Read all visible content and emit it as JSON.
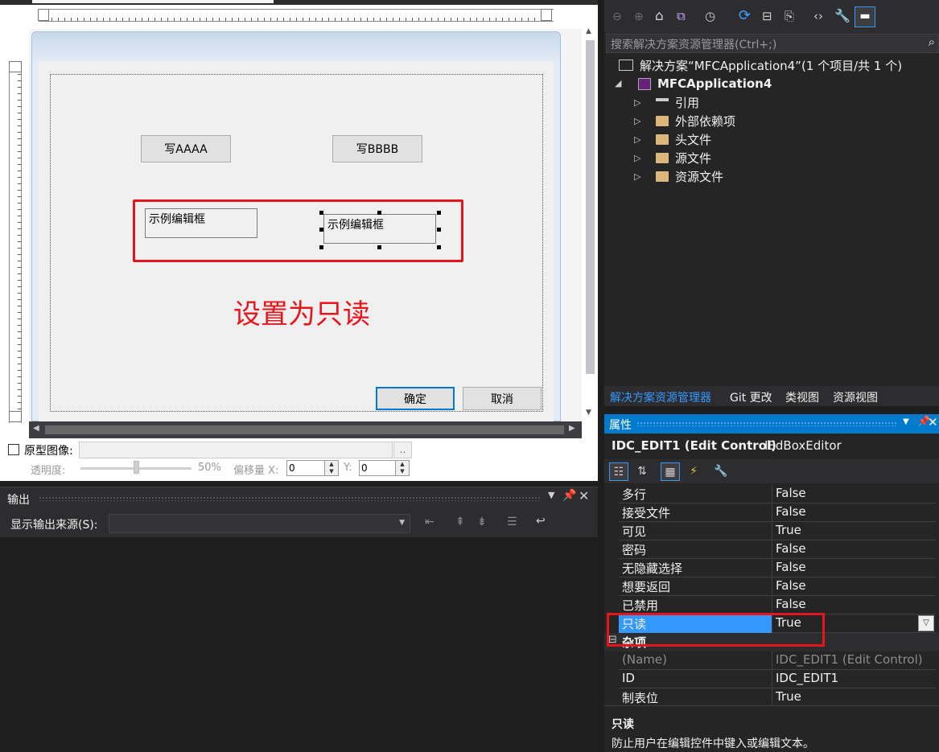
{
  "designer": {
    "button1": "写AAAA",
    "button2": "写BBBB",
    "edit1": "示例编辑框",
    "edit2": "示例编辑框",
    "annotation": "设置为只读",
    "ok_button": "确定",
    "cancel_button": "取消"
  },
  "prototype": {
    "label": "原型图像:",
    "browse": "..",
    "opacity_label": "透明度:",
    "opacity_value": "50%",
    "offset_label": "偏移量 X:",
    "x_value": "0",
    "y_label": "Y:",
    "y_value": "0"
  },
  "output": {
    "title": "输出",
    "source_label": "显示输出来源(S):"
  },
  "solution_explorer": {
    "search_placeholder": "搜索解决方案资源管理器(Ctrl+;)",
    "solution_label": "解决方案“MFCApplication4”(1 个项目/共 1 个)",
    "project": "MFCApplication4",
    "items": [
      "引用",
      "外部依赖项",
      "头文件",
      "源文件",
      "资源文件"
    ],
    "tabs": [
      "解决方案资源管理器",
      "Git 更改",
      "类视图",
      "资源视图"
    ]
  },
  "properties": {
    "title": "属性",
    "object": "IDC_EDIT1 (Edit Control)",
    "editor": "IEdBoxEditor",
    "rows": [
      {
        "k": "多行",
        "v": "False"
      },
      {
        "k": "接受文件",
        "v": "False"
      },
      {
        "k": "可见",
        "v": "True"
      },
      {
        "k": "密码",
        "v": "False"
      },
      {
        "k": "无隐藏选择",
        "v": "False"
      },
      {
        "k": "想要返回",
        "v": "False"
      },
      {
        "k": "已禁用",
        "v": "False"
      },
      {
        "k": "只读",
        "v": "True"
      }
    ],
    "category": "杂项",
    "misc_rows": [
      {
        "k": "(Name)",
        "v": "IDC_EDIT1 (Edit Control)"
      },
      {
        "k": "ID",
        "v": "IDC_EDIT1"
      },
      {
        "k": "制表位",
        "v": "True"
      }
    ],
    "desc_title": "只读",
    "desc_text": "防止用户在编辑控件中键入或编辑文本。"
  },
  "colors": {
    "accent": "#007acc",
    "selected_row": "#3399ff",
    "annotation_red": "#e8141c"
  }
}
